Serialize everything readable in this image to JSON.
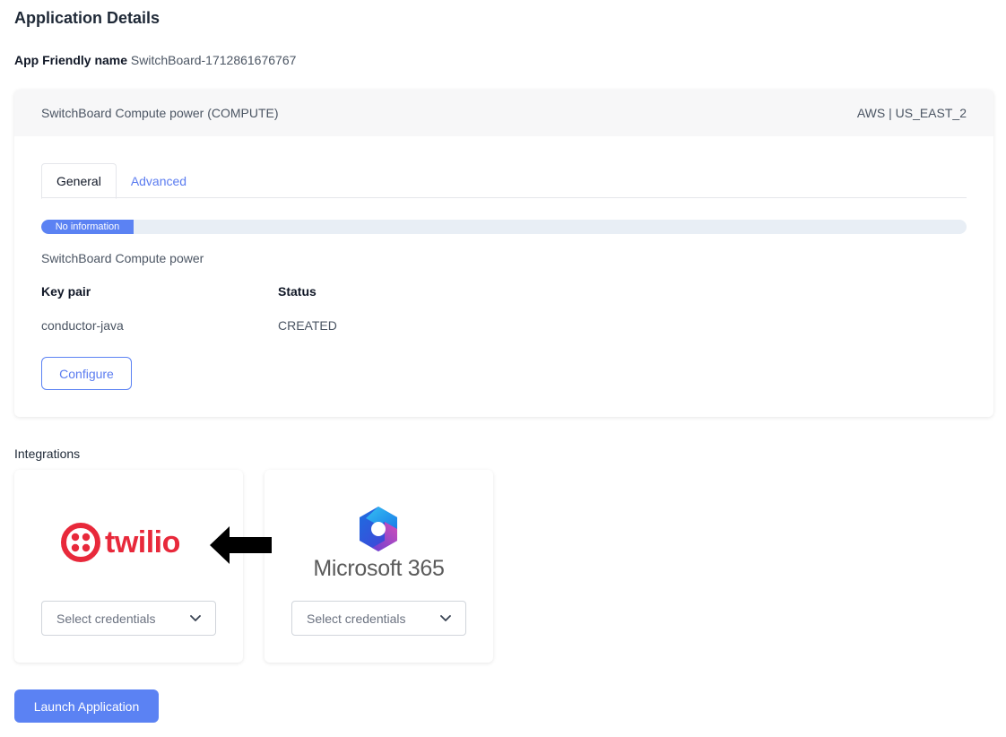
{
  "page": {
    "title": "Application Details",
    "friendly_name_label": "App Friendly name",
    "friendly_name_value": "SwitchBoard-1712861676767"
  },
  "resource": {
    "name": "SwitchBoard Compute power (COMPUTE)",
    "region": "AWS | US_EAST_2",
    "tabs": [
      {
        "label": "General",
        "active": true
      },
      {
        "label": "Advanced",
        "active": false
      }
    ],
    "progress_label": "No information",
    "description": "SwitchBoard Compute power",
    "key_pair_label": "Key pair",
    "key_pair_value": "conductor-java",
    "status_label": "Status",
    "status_value": "CREATED",
    "configure_label": "Configure"
  },
  "integrations": {
    "title": "Integrations",
    "items": [
      {
        "name": "twilio",
        "logo_text": "twilio",
        "select_placeholder": "Select credentials",
        "icon": "twilio-logo-icon",
        "color": "#e8293b"
      },
      {
        "name": "microsoft-365",
        "logo_text": "Microsoft 365",
        "select_placeholder": "Select credentials",
        "icon": "microsoft-365-logo-icon"
      }
    ]
  },
  "annotation": {
    "icon": "left-arrow-icon",
    "color": "#000000"
  },
  "actions": {
    "launch_label": "Launch Application"
  },
  "colors": {
    "accent": "#5b82f3",
    "link": "#5b7cf0",
    "twilio_red": "#e8293b"
  }
}
